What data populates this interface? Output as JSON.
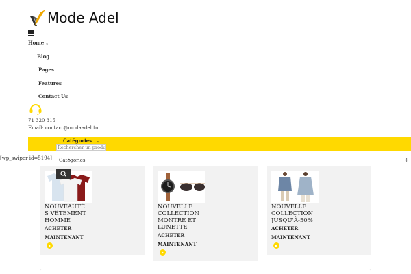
{
  "brand": {
    "name": "Mode Adel",
    "logo_icon": "check-swoosh-logo",
    "accent_color": "#ffd900"
  },
  "nav": {
    "home": "Home",
    "blog": "Blog",
    "pages": "Pages",
    "features": "Features",
    "contact": "Contact Us"
  },
  "contact": {
    "support_icon": "headset-icon",
    "phone": "71 320 315",
    "email": "Email: contact@modaadel.tn"
  },
  "toolbar": {
    "categories_label": "Catégories",
    "search_placeholder": "Rechercher un produit",
    "shortcode": "[wp_swiper id=5194]",
    "select_label": "Catégories"
  },
  "cards": [
    {
      "title_lines": [
        "NOUVEAUTÉ",
        "S VÊTEMENT",
        "HOMME"
      ],
      "cta_lines": [
        "ACHETER",
        "MAINTENANT"
      ]
    },
    {
      "title_lines": [
        "NOUVELLE",
        "COLLECTION",
        "MONTRE ET",
        "LUNETTE"
      ],
      "cta_lines": [
        "ACHETER",
        "MAINTENANT"
      ]
    },
    {
      "title_lines": [
        "NOUVELLE",
        "COLLECTION",
        "JUSQU'À-50%"
      ],
      "cta_lines": [
        "ACHETER",
        "MAINTENANT"
      ]
    }
  ]
}
